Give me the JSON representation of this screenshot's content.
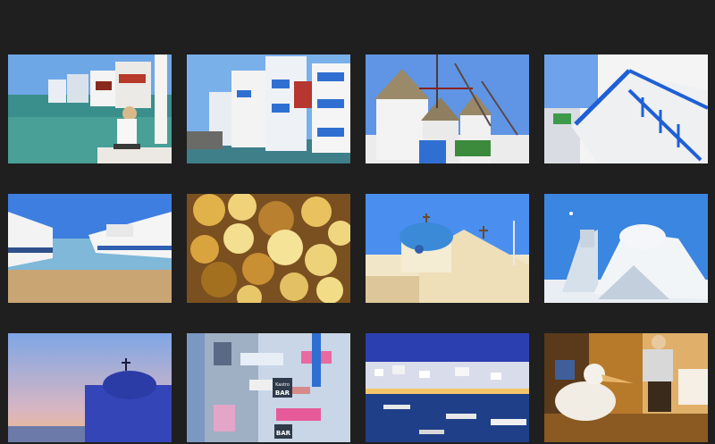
{
  "gallery": {
    "photos": [
      {
        "icon": "little-venice-seafront-photo"
      },
      {
        "icon": "blue-balcony-houses-photo"
      },
      {
        "icon": "windmills-photo"
      },
      {
        "icon": "blue-staircase-photo"
      },
      {
        "icon": "moored-boats-photo"
      },
      {
        "icon": "sea-sponges-photo"
      },
      {
        "icon": "blue-dome-chapel-photo"
      },
      {
        "icon": "paraportiani-church-photo"
      },
      {
        "icon": "sunset-chapel-photo"
      },
      {
        "icon": "kastro-bar-balconies-photo"
      },
      {
        "icon": "harbour-at-dusk-photo"
      },
      {
        "icon": "pelican-cafe-photo"
      }
    ],
    "signs": {
      "bar_sign_line1": "Kastro",
      "bar_sign_line2": "BAR",
      "lower_sign": "BAR"
    }
  },
  "colors": {
    "background": "#1f1f1f",
    "aegean_blue": "#2f6fd1",
    "whitewash": "#f2f2f2"
  }
}
